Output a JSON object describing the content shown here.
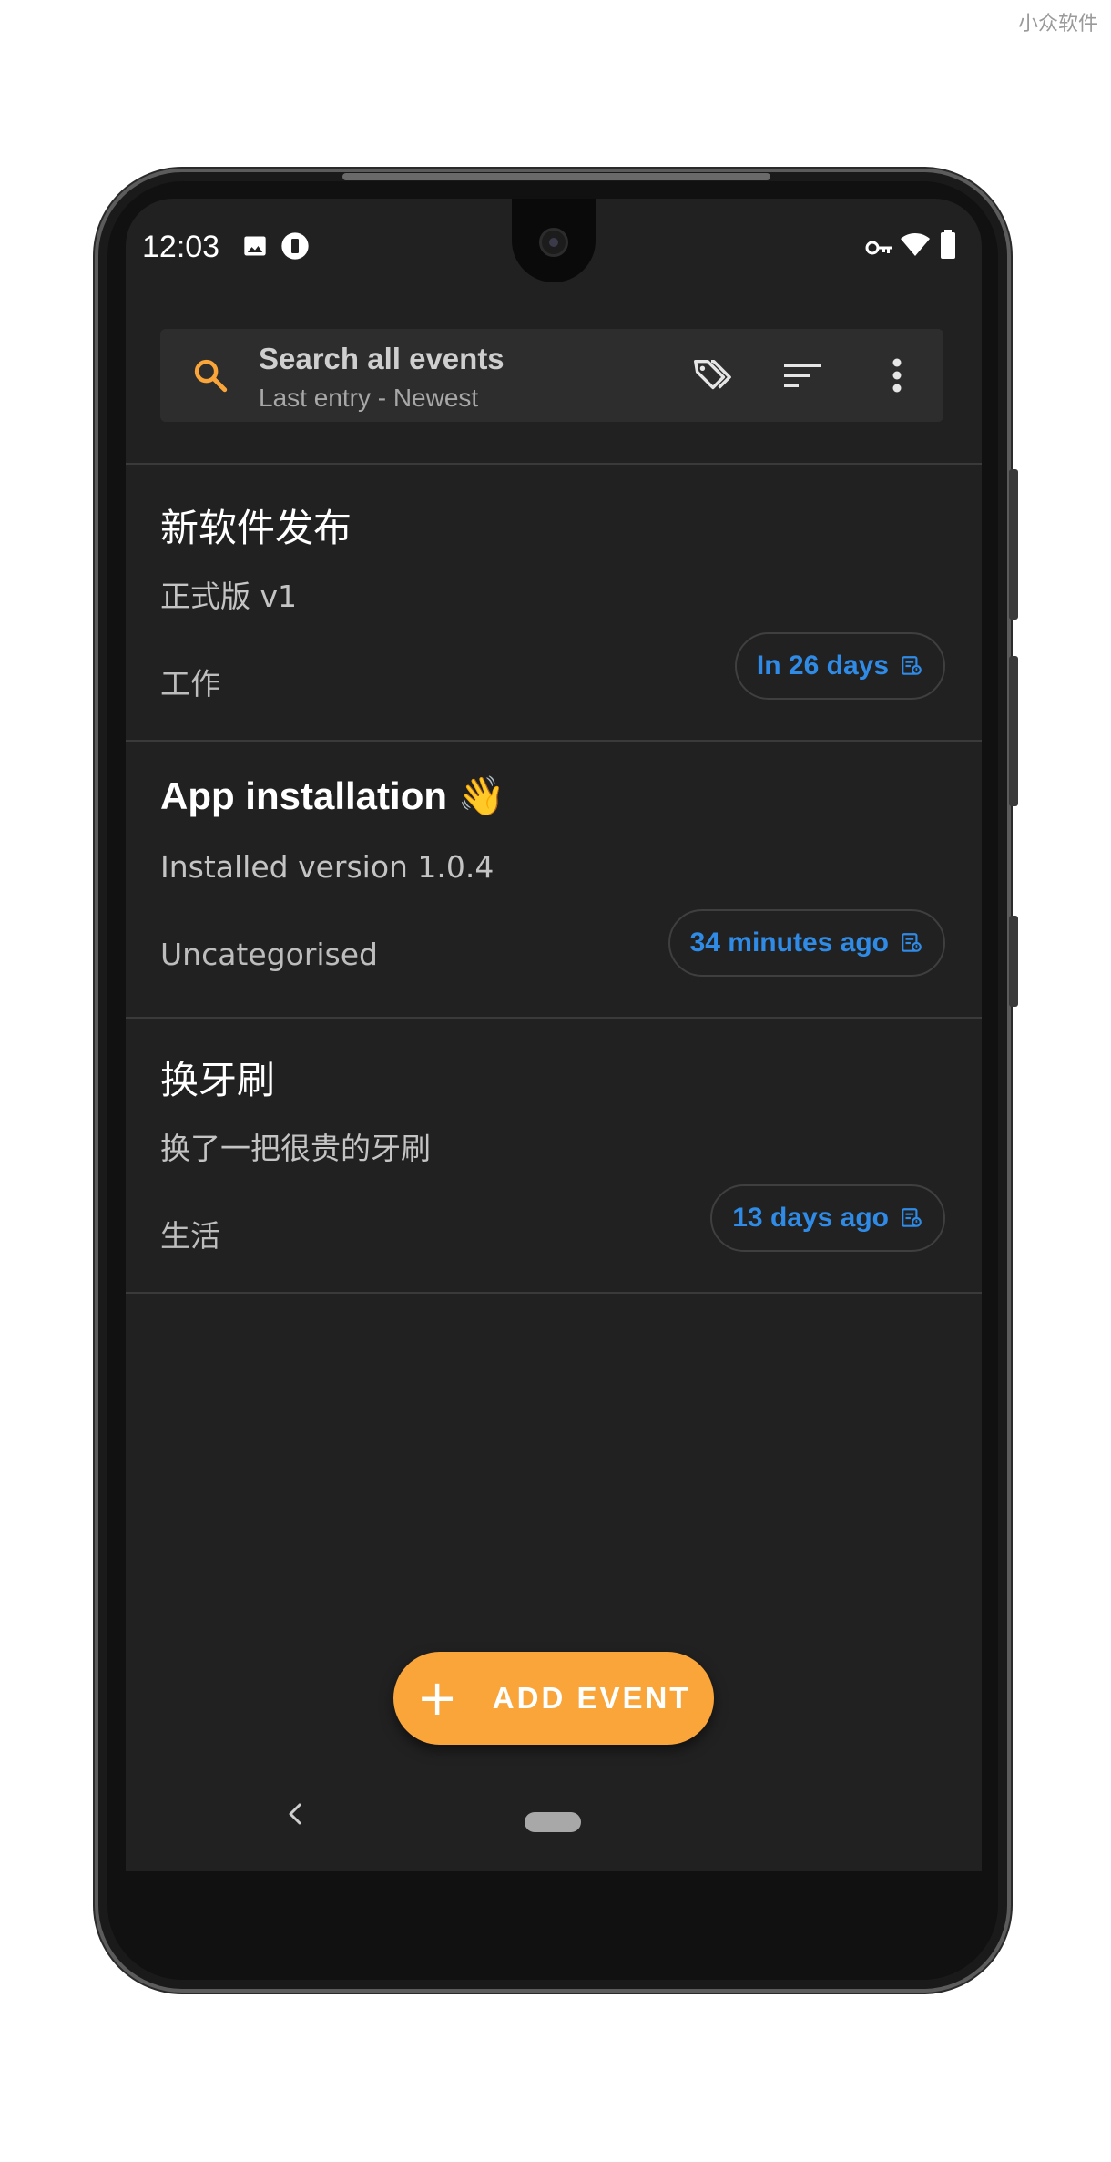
{
  "watermark": "小众软件",
  "status_bar": {
    "time": "12:03",
    "left_icons": [
      "image-icon",
      "notification-icon"
    ],
    "right_icons": [
      "vpn-key-icon",
      "wifi-icon",
      "battery-icon"
    ]
  },
  "search": {
    "title": "Search all events",
    "subtitle": "Last entry - Newest",
    "actions": [
      "tag-icon",
      "sort-icon",
      "more-vert-icon"
    ]
  },
  "events": [
    {
      "title": "新软件发布",
      "description": "正式版 v1",
      "category": "工作",
      "time_label": "In 26 days"
    },
    {
      "title": "App installation 👋",
      "description": "Installed version 1.0.4",
      "category": "Uncategorised",
      "time_label": "34 minutes ago"
    },
    {
      "title": "换牙刷",
      "description": "换了一把很贵的牙刷",
      "category": "生活",
      "time_label": "13 days ago"
    }
  ],
  "fab": {
    "icon": "+",
    "label": "ADD EVENT"
  },
  "colors": {
    "background": "#212121",
    "accent": "#f9a53a",
    "chip_text": "#2f8be6",
    "search_icon": "#f9a53a"
  }
}
